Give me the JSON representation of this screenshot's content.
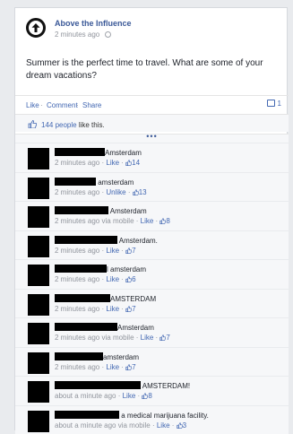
{
  "post": {
    "page_name": "Above the Influence",
    "time": "2 minutes ago",
    "message": "Summer is the perfect time to travel. What are some of your dream vacations?",
    "actions": {
      "like": "Like",
      "comment": "Comment",
      "share": "Share",
      "sep": "·"
    },
    "comment_count": "1",
    "likes_count_text": "144 people",
    "likes_suffix": "like this.",
    "more_dots": "•••"
  },
  "comments": [
    {
      "text": "Amsterdam",
      "time": "2 minutes ago",
      "via": "",
      "like": "Like",
      "count": "14"
    },
    {
      "text": "amsterdam",
      "time": "2 minutes ago",
      "via": "",
      "like": "Unlike",
      "count": "13"
    },
    {
      "text": "Amsterdam",
      "time": "2 minutes ago",
      "via": "via mobile",
      "like": "Like",
      "count": "8"
    },
    {
      "text": "Amsterdam.",
      "time": "2 minutes ago",
      "via": "",
      "like": "Like",
      "count": "7"
    },
    {
      "text": "l amsterdam",
      "time": "2 minutes ago",
      "via": "",
      "like": "Like",
      "count": "6"
    },
    {
      "text": "AMSTERDAM",
      "time": "2 minutes ago",
      "via": "",
      "like": "Like",
      "count": "7"
    },
    {
      "text": "Amsterdam",
      "time": "2 minutes ago",
      "via": "via mobile",
      "like": "Like",
      "count": "7"
    },
    {
      "text": "amsterdam",
      "time": "2 minutes ago",
      "via": "",
      "like": "Like",
      "count": "7"
    },
    {
      "text": "AMSTERDAM!",
      "time": "about a minute ago",
      "via": "",
      "like": "Like",
      "count": "8"
    },
    {
      "text": "a medical marijuana facility.",
      "time": "about a minute ago",
      "via": "via mobile",
      "like": "Like",
      "count": "3"
    }
  ],
  "colors": {
    "link": "#4267b2",
    "meta": "#90949c",
    "background": "#f6f7f9"
  },
  "icons": [
    "upload-arrow-logo-icon",
    "globe-icon",
    "speech-bubble-icon",
    "thumbs-up-icon",
    "redaction-bar"
  ]
}
